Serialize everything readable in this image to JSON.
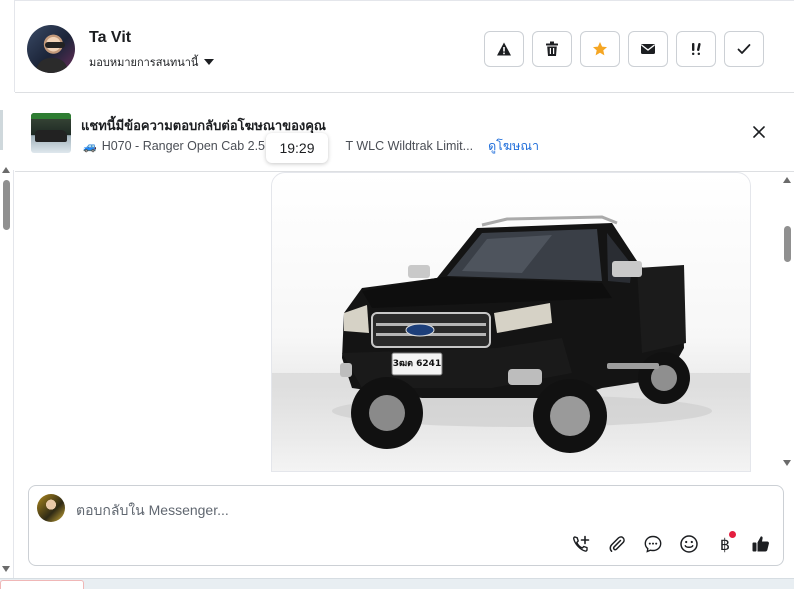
{
  "contact": {
    "name": "Ta Vit",
    "assign_label": "มอบหมายการสนทนานี้"
  },
  "toolbar": {
    "buttons": [
      {
        "name": "report-spam",
        "icon": "warning-triangle-icon"
      },
      {
        "name": "delete",
        "icon": "trash-icon"
      },
      {
        "name": "star",
        "icon": "star-icon",
        "color": "#f5a623"
      },
      {
        "name": "mark-unread",
        "icon": "envelope-icon"
      },
      {
        "name": "follow-up",
        "icon": "exclamation-icon"
      },
      {
        "name": "mark-done",
        "icon": "check-icon"
      }
    ]
  },
  "ad_context": {
    "title": "แชทนี้มีข้อความตอบกลับต่อโฆษณาของคุณ",
    "subtitle": "H070 - Ranger Open Cab 2.5 H",
    "subtitle_tail": "T WLC Wildtrak Limit...",
    "link_label": "ดูโฆษณา",
    "link_color": "#216fdb"
  },
  "message": {
    "timestamp": "19:29",
    "image_alt": "black Ford Ranger pickup truck",
    "plate_text": "3ฒต 6241"
  },
  "composer": {
    "placeholder": "ตอบกลับใน Messenger...",
    "tools": [
      "add-call-icon",
      "paperclip-icon",
      "chat-bubble-icon",
      "smiley-icon",
      "baht-icon",
      "thumbs-up-icon"
    ],
    "baht_symbol": "฿"
  },
  "colors": {
    "accent": "#216fdb",
    "star": "#f5a623",
    "badge": "#e41e3f"
  }
}
